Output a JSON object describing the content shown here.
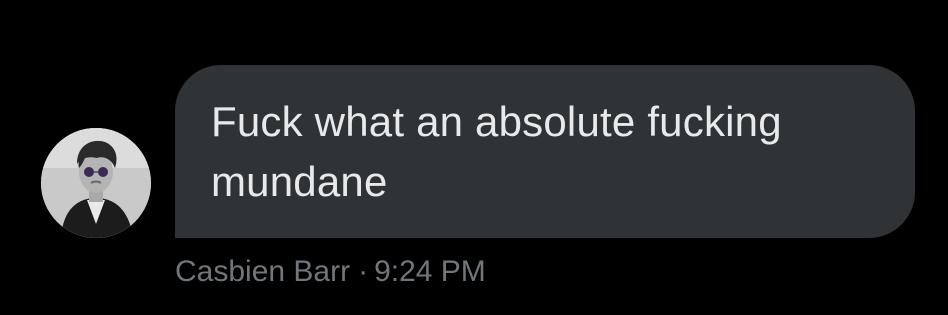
{
  "message": {
    "text": "Fuck what an absolute fucking mundane",
    "sender_name": "Casbien Barr",
    "separator": "·",
    "timestamp": "9:24 PM"
  },
  "colors": {
    "background": "#000000",
    "bubble": "#2f3336",
    "message_text": "#e7e9ea",
    "meta_text": "#71767b"
  },
  "icons": {
    "avatar": "user-avatar-photo"
  }
}
